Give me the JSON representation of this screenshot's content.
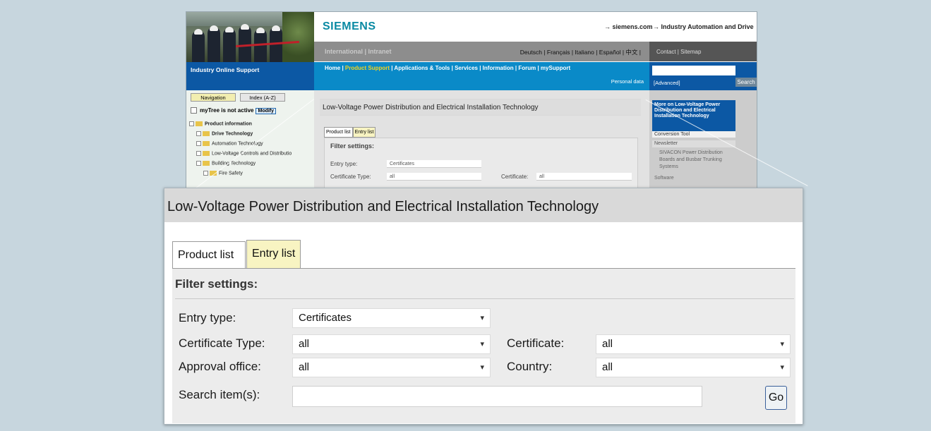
{
  "site": {
    "brand": "SIEMENS",
    "ext_link_1": "→ siemens.com",
    "ext_link_2": "→ Industry Automation and Drive",
    "intl": "International | Intranet",
    "languages": "Deutsch | Français | Italiano | Español | 中文 |",
    "contact": "Contact | Sitemap",
    "section": "Industry Online Support",
    "nav_links_pre": "Home | ",
    "nav_active": "Product Support",
    "nav_links_post": " | Applications & Tools | Services | Information | Forum | mySupport",
    "personal": "Personal data",
    "advanced": "[Advanced]",
    "search_btn": "Search"
  },
  "leftnav": {
    "tab_nav": "Navigation",
    "tab_index": "Index (A-Z)",
    "mytree": "myTree is not active",
    "modify": "Modify",
    "items": [
      "Product information",
      "Drive Technology",
      "Automation Technology",
      "Low-Voltage Controls and Distributio",
      "Building Technology",
      "Fire Safety"
    ]
  },
  "small": {
    "title": "Low-Voltage Power Distribution and Electrical Installation Technology",
    "tab1": "Product list",
    "tab2": "Entry list",
    "filter": "Filter settings:",
    "entry_type_label": "Entry type:",
    "entry_type_value": "Certificates",
    "cert_type_label": "Certificate Type:",
    "cert_type_value": "all",
    "cert_label": "Certificate:",
    "cert_value": "all"
  },
  "rightcol": {
    "more": "More on Low-Voltage Power Distribution and Electrical Installation Technology",
    "conversion": "Conversion Tool",
    "newsletter": "Newsletter",
    "sivacon": "SIVACON Power Distribution Boards and Busbar Trunking Systems",
    "software": "Software"
  },
  "zoom": {
    "title": "Low-Voltage Power Distribution and Electrical Installation Technology",
    "tab_product": "Product list",
    "tab_entry": "Entry list",
    "filter": "Filter settings:",
    "entry_type_label": "Entry type:",
    "entry_type_value": "Certificates",
    "cert_type_label": "Certificate Type:",
    "cert_type_value": "all",
    "approval_label": "Approval office:",
    "approval_value": "all",
    "certificate_label": "Certificate:",
    "certificate_value": "all",
    "country_label": "Country:",
    "country_value": "all",
    "search_label": "Search item(s):",
    "search_value": "",
    "go": "Go",
    "dropdown_arrow": "▾"
  },
  "colors": {
    "siemens_teal": "#0a8aa3",
    "nav_blue": "#0a8ac8",
    "dark_blue": "#0c58a4",
    "tab_active": "#f8f4c2",
    "page_bg": "#c7d6de"
  }
}
